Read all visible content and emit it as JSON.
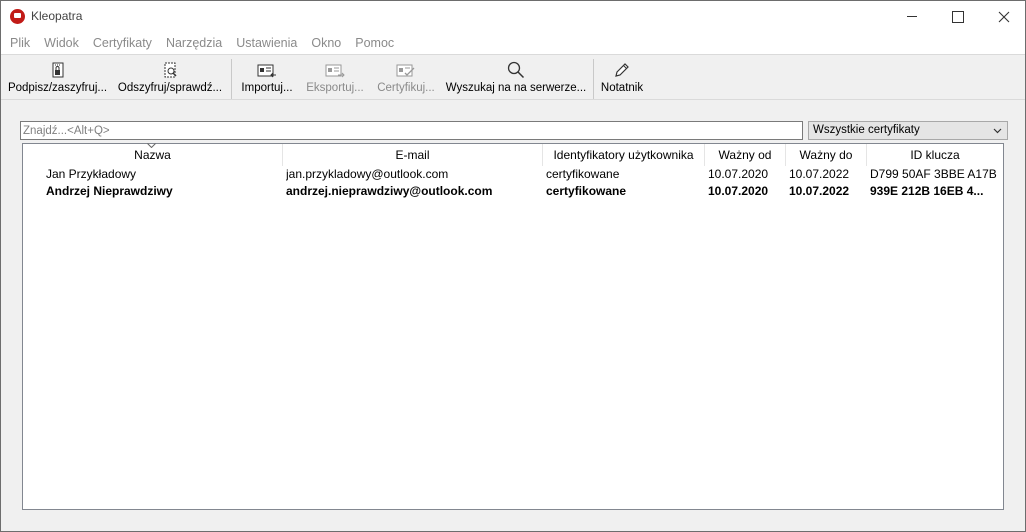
{
  "window": {
    "title": "Kleopatra"
  },
  "menu": [
    "Plik",
    "Widok",
    "Certyfikaty",
    "Narzędzia",
    "Ustawienia",
    "Okno",
    "Pomoc"
  ],
  "toolbar": {
    "sign_encrypt": "Podpisz/zaszyfruj...",
    "decrypt_verify": "Odszyfruj/sprawdź...",
    "import": "Importuj...",
    "export": "Eksportuj...",
    "certify": "Certyfikuj...",
    "lookup_server": "Wyszukaj na na serwerze...",
    "notepad": "Notatnik"
  },
  "search": {
    "placeholder": "Znajdź...<Alt+Q>",
    "value": ""
  },
  "filter": {
    "selected": "Wszystkie certyfikaty"
  },
  "table": {
    "headers": [
      "Nazwa",
      "E-mail",
      "Identyfikatory użytkownika",
      "Ważny od",
      "Ważny do",
      "ID klucza"
    ],
    "rows": [
      {
        "name": "Jan Przykładowy",
        "email": "jan.przykladowy@outlook.com",
        "user_ids": "certyfikowane",
        "valid_from": "10.07.2020",
        "valid_to": "10.07.2022",
        "key_id": "D799 50AF 3BBE A17B",
        "bold": false
      },
      {
        "name": "Andrzej Nieprawdziwy",
        "email": "andrzej.nieprawdziwy@outlook.com",
        "user_ids": "certyfikowane",
        "valid_from": "10.07.2020",
        "valid_to": "10.07.2022",
        "key_id": "939E 212B 16EB 4...",
        "bold": true
      }
    ]
  },
  "colors": {
    "accent": "#c11b17",
    "disabled_text": "#8a8a8a"
  },
  "icons": {
    "app": "kleopatra-logo-icon",
    "sign": "sign-encrypt-icon",
    "decrypt": "decrypt-verify-icon",
    "import": "import-certificate-icon",
    "export": "export-certificate-icon",
    "certify": "certify-icon",
    "lookup": "search-magnifier-icon",
    "notepad": "pencil-icon"
  }
}
